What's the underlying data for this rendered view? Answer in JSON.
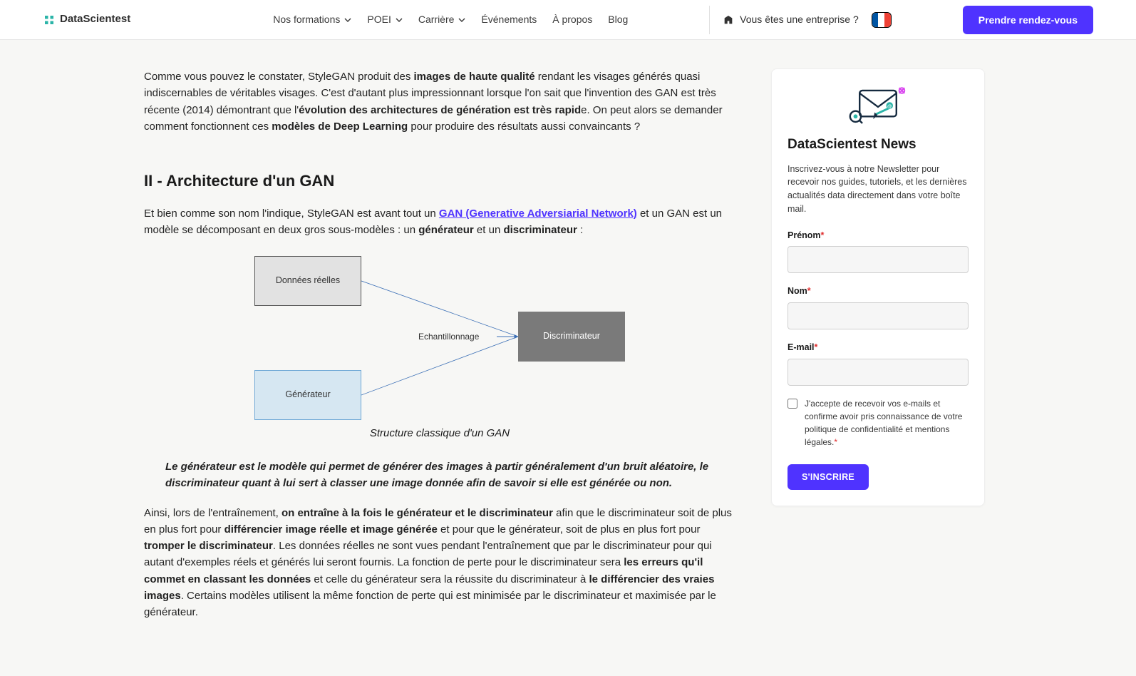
{
  "header": {
    "brand": "DataScientest",
    "nav": {
      "formations": "Nos formations",
      "poei": "POEI",
      "carriere": "Carrière",
      "evenements": "Événements",
      "apropos": "À propos",
      "blog": "Blog"
    },
    "enterprise": "Vous êtes une entreprise ?",
    "cta": "Prendre rendez-vous"
  },
  "article": {
    "p1": {
      "t1": "Comme vous pouvez le constater, StyleGAN produit des ",
      "b1": "images de haute qualité",
      "t2": " rendant les visages générés quasi indiscernables de véritables visages. C'est d'autant plus impressionnant lorsque l'on sait que l'invention des GAN est très récente (2014) démontrant que l'",
      "b2": "évolution des architectures de génération est très rapid",
      "t3": "e. On peut alors se demander comment fonctionnent ces ",
      "b3": "modèles de Deep Learning",
      "t4": " pour produire des résultats aussi convaincants ?"
    },
    "h2": "II - Architecture d'un GAN",
    "p2": {
      "t1": "Et bien comme son nom l'indique, StyleGAN est avant tout un ",
      "link": "GAN (Generative Adversiarial Network)",
      "t2": " et un GAN est un modèle se décomposant en deux gros sous-modèles : un ",
      "b1": "générateur",
      "t3": " et un ",
      "b2": "discriminateur",
      "t4": " :"
    },
    "diagram": {
      "real_data": "Données réelles",
      "generator": "Générateur",
      "sampling": "Echantillonnage",
      "discriminator": "Discriminateur",
      "caption": "Structure classique d'un GAN"
    },
    "quote": "Le générateur est le modèle qui permet de générer des images à partir généralement d'un bruit aléatoire, le discriminateur quant à lui sert à classer une image donnée afin de savoir si elle est générée ou non.",
    "p3": {
      "t1": "Ainsi, lors de l'entraînement, ",
      "b1": "on entraîne à la fois le générateur et le discriminateur",
      "t2": " afin que le discriminateur soit de plus en plus fort pour ",
      "b2": "différencier image réelle et image générée",
      "t3": " et pour que le générateur, soit de plus en plus fort pour ",
      "b3": "tromper le discriminateur",
      "t4": ". Les données réelles ne sont vues pendant l'entraînement que par le discriminateur pour qui autant d'exemples réels et générés lui seront fournis. La fonction de perte pour le discriminateur sera ",
      "b4": "les erreurs qu'il commet en classant les données",
      "t5": " et celle du générateur sera la réussite du discriminateur à ",
      "b5": "le différencier des vraies images",
      "t6": ". Certains modèles utilisent la même fonction de perte qui est minimisée par le discriminateur et maximisée par le générateur."
    }
  },
  "news": {
    "title": "DataScientest News",
    "desc": "Inscrivez-vous à notre Newsletter pour recevoir nos guides, tutoriels, et les dernières actualités data directement dans votre boîte mail.",
    "prenom_label": "Prénom",
    "nom_label": "Nom",
    "email_label": "E-mail",
    "star": "*",
    "consent": "J'accepte de recevoir vos e-mails et confirme avoir pris connaissance de votre politique de confidentialité et mentions légales.",
    "submit": "S'INSCRIRE"
  }
}
